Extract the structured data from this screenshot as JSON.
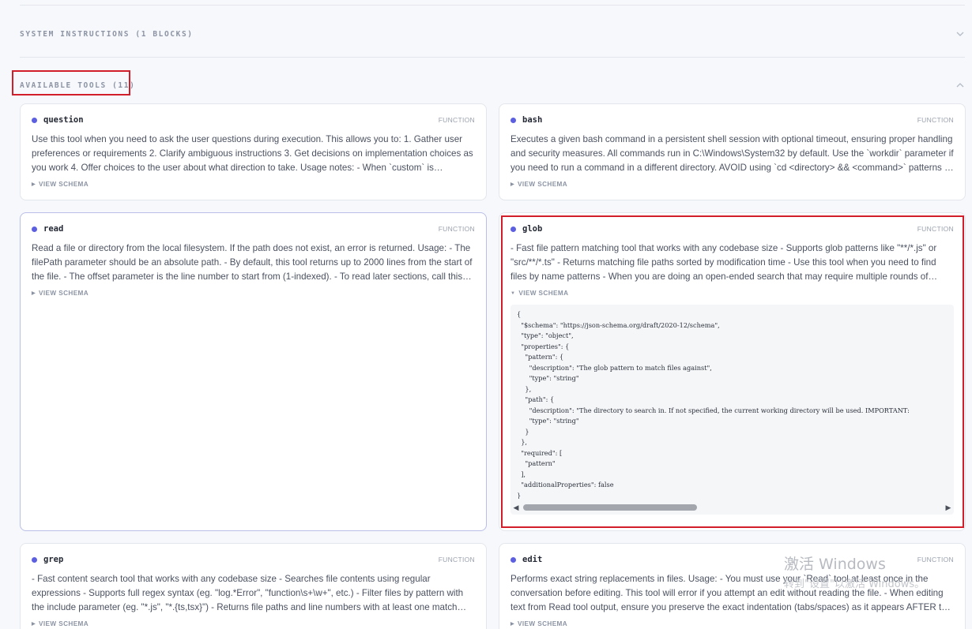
{
  "sections": {
    "system": {
      "title": "SYSTEM INSTRUCTIONS (1 BLOCKS)"
    },
    "tools": {
      "title": "AVAILABLE TOOLS (11)"
    }
  },
  "schema_toggle_label": "VIEW SCHEMA",
  "tools": [
    {
      "name": "question",
      "kind": "FUNCTION",
      "description": "Use this tool when you need to ask the user questions during execution. This allows you to: 1. Gather user preferences or requirements 2. Clarify ambiguous instructions 3. Get decisions on implementation choices as you work 4. Offer choices to the user about what direction to take. Usage notes: - When `custom` is enabled…"
    },
    {
      "name": "bash",
      "kind": "FUNCTION",
      "description": "Executes a given bash command in a persistent shell session with optional timeout, ensuring proper handling and security measures. All commands run in C:\\Windows\\System32 by default. Use the `workdir` parameter if you need to run a command in a different directory. AVOID using `cd <directory> && <command>` patterns - u…"
    },
    {
      "name": "read",
      "kind": "FUNCTION",
      "description": "Read a file or directory from the local filesystem. If the path does not exist, an error is returned. Usage: - The filePath parameter should be an absolute path. - By default, this tool returns up to 2000 lines from the start of the file. - The offset parameter is the line number to start from (1-indexed). - To read later sections, call this too…"
    },
    {
      "name": "glob",
      "kind": "FUNCTION",
      "description": "- Fast file pattern matching tool that works with any codebase size - Supports glob patterns like \"**/*.js\" or \"src/**/*.ts\" - Returns matching file paths sorted by modification time - Use this tool when you need to find files by name patterns - When you are doing an open-ended search that may require multiple rounds of globbing a…",
      "schema_text": "{\n  \"$schema\": \"https://json-schema.org/draft/2020-12/schema\",\n  \"type\": \"object\",\n  \"properties\": {\n    \"pattern\": {\n      \"description\": \"The glob pattern to match files against\",\n      \"type\": \"string\"\n    },\n    \"path\": {\n      \"description\": \"The directory to search in. If not specified, the current working directory will be used. IMPORTANT:\n      \"type\": \"string\"\n    }\n  },\n  \"required\": [\n    \"pattern\"\n  ],\n  \"additionalProperties\": false\n}"
    },
    {
      "name": "grep",
      "kind": "FUNCTION",
      "description": "- Fast content search tool that works with any codebase size - Searches file contents using regular expressions - Supports full regex syntax (eg. \"log.*Error\", \"function\\s+\\w+\", etc.) - Filter files by pattern with the include parameter (eg. \"*.js\", \"*.{ts,tsx}\") - Returns file paths and line numbers with at least one match sorted by…"
    },
    {
      "name": "edit",
      "kind": "FUNCTION",
      "description": "Performs exact string replacements in files. Usage: - You must use your `Read` tool at least once in the conversation before editing. This tool will error if you attempt an edit without reading the file. - When editing text from Read tool output, ensure you preserve the exact indentation (tabs/spaces) as it appears AFTER the li…"
    }
  ],
  "watermark": {
    "title": "激活 Windows",
    "subtitle": "转到\"设置\"以激活 Windows。"
  }
}
